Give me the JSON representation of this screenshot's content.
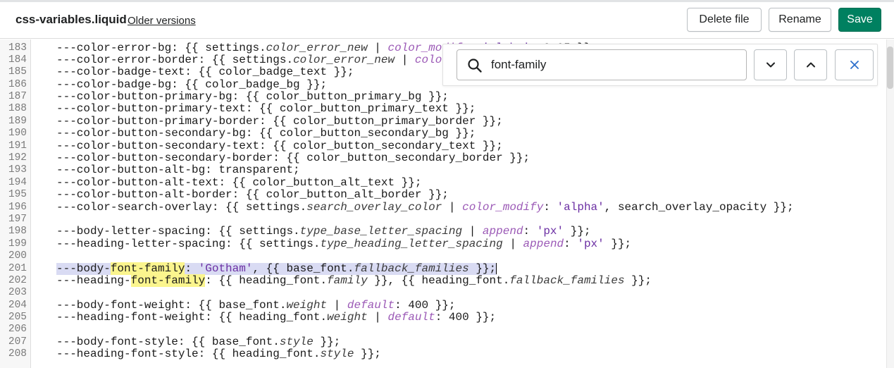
{
  "header": {
    "file_name": "css-variables.liquid",
    "older_versions_label": "Older versions",
    "delete_label": "Delete file",
    "rename_label": "Rename",
    "save_label": "Save"
  },
  "search": {
    "query": "font-family",
    "icon": "search-icon",
    "next_icon": "chevron-down-icon",
    "prev_icon": "chevron-up-icon",
    "close_icon": "close-icon"
  },
  "colors": {
    "save_button": "#008060",
    "selection": "#d9dbf3",
    "match_highlight": "#fbf58e",
    "liquid_filter": "#9b59b6",
    "liquid_string": "#6b2fa3"
  },
  "editor": {
    "lines": [
      {
        "num": "183",
        "code": "---color-error-bg: {{ settings.color_error_new | color_modify: 'alpha', 0.05 }};"
      },
      {
        "num": "184",
        "code": "---color-error-border: {{ settings.color_error_new | color_modify: 'alpha', 0.3 }};"
      },
      {
        "num": "185",
        "code": "---color-badge-text: {{ color_badge_text }};"
      },
      {
        "num": "186",
        "code": "---color-badge-bg: {{ color_badge_bg }};"
      },
      {
        "num": "187",
        "code": "---color-button-primary-bg: {{ color_button_primary_bg }};"
      },
      {
        "num": "188",
        "code": "---color-button-primary-text: {{ color_button_primary_text }};"
      },
      {
        "num": "189",
        "code": "---color-button-primary-border: {{ color_button_primary_border }};"
      },
      {
        "num": "190",
        "code": "---color-button-secondary-bg: {{ color_button_secondary_bg }};"
      },
      {
        "num": "191",
        "code": "---color-button-secondary-text: {{ color_button_secondary_text }};"
      },
      {
        "num": "192",
        "code": "---color-button-secondary-border: {{ color_button_secondary_border }};"
      },
      {
        "num": "193",
        "code": "---color-button-alt-bg: transparent;"
      },
      {
        "num": "194",
        "code": "---color-button-alt-text: {{ color_button_alt_text }};"
      },
      {
        "num": "195",
        "code": "---color-button-alt-border: {{ color_button_alt_border }};"
      },
      {
        "num": "196",
        "code": "---color-search-overlay: {{ settings.search_overlay_color | color_modify: 'alpha', search_overlay_opacity }};"
      },
      {
        "num": "197",
        "code": ""
      },
      {
        "num": "198",
        "code": "---body-letter-spacing: {{ settings.type_base_letter_spacing | append: 'px' }};"
      },
      {
        "num": "199",
        "code": "---heading-letter-spacing: {{ settings.type_heading_letter_spacing | append: 'px' }};"
      },
      {
        "num": "200",
        "code": ""
      },
      {
        "num": "201",
        "code": "---body-font-family: 'Gotham', {{ base_font.fallback_families }};"
      },
      {
        "num": "202",
        "code": "---heading-font-family: {{ heading_font.family }}, {{ heading_font.fallback_families }};"
      },
      {
        "num": "203",
        "code": ""
      },
      {
        "num": "204",
        "code": "---body-font-weight: {{ base_font.weight | default: 400 }};"
      },
      {
        "num": "205",
        "code": "---heading-font-weight: {{ heading_font.weight | default: 400 }};"
      },
      {
        "num": "206",
        "code": ""
      },
      {
        "num": "207",
        "code": "---body-font-style: {{ base_font.style }};"
      },
      {
        "num": "208",
        "code": "---heading-font-style: {{ heading_font.style }};"
      }
    ]
  }
}
